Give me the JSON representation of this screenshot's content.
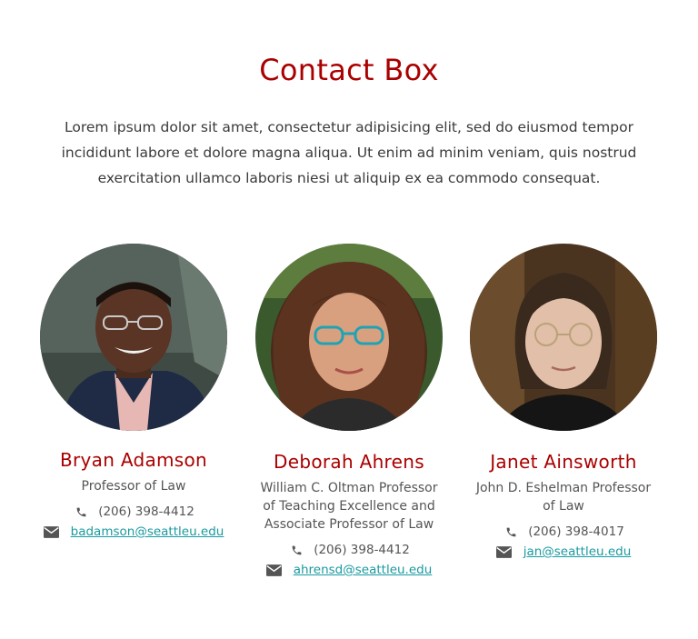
{
  "header": {
    "title": "Contact Box",
    "intro": "Lorem ipsum dolor sit amet, consectetur adipisicing elit, sed do eiusmod tempor incididunt labore et dolore magna aliqua. Ut enim ad minim veniam, quis nostrud exercitation ullamco laboris niesi ut aliquip ex ea commodo consequat."
  },
  "contacts": [
    {
      "name": "Bryan Adamson",
      "role": "Professor of Law",
      "phone": "(206) 398-4412",
      "email": "badamson@seattleu.edu",
      "phone_icon": "phone-icon",
      "email_icon": "envelope-icon"
    },
    {
      "name": "Deborah Ahrens",
      "role": "William C. Oltman Professor of Teaching Excellence and Associate Professor of Law",
      "phone": "(206) 398-4412",
      "email": "ahrensd@seattleu.edu",
      "phone_icon": "phone-icon",
      "email_icon": "envelope-icon"
    },
    {
      "name": "Janet Ainsworth",
      "role": "John D. Eshelman Professor of Law",
      "phone": "(206) 398-4017",
      "email": "jan@seattleu.edu",
      "phone_icon": "phone-icon",
      "email_icon": "envelope-icon"
    }
  ],
  "colors": {
    "accent": "#aa0000",
    "link": "#1a9aa0"
  }
}
